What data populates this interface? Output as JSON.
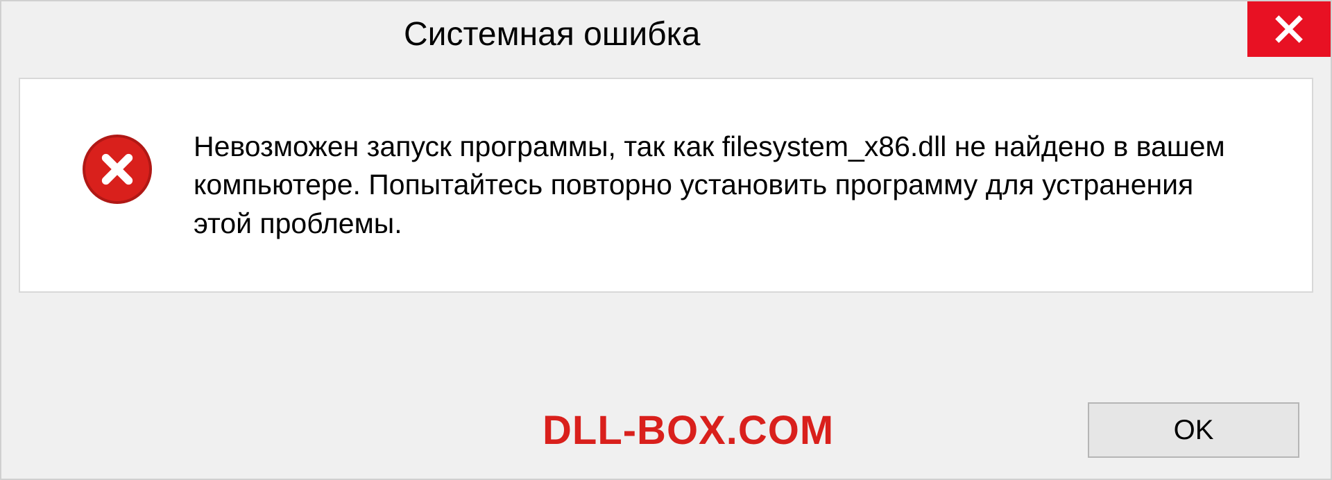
{
  "dialog": {
    "title": "Системная ошибка",
    "message": "Невозможен запуск программы, так как filesystem_x86.dll  не найдено в вашем компьютере. Попытайтесь повторно установить программу для устранения этой проблемы.",
    "ok_label": "OK"
  },
  "watermark": "DLL-BOX.COM",
  "colors": {
    "close_button": "#e81123",
    "error_icon": "#d9201c",
    "watermark": "#d9201c",
    "panel_bg": "#f0f0f0"
  }
}
